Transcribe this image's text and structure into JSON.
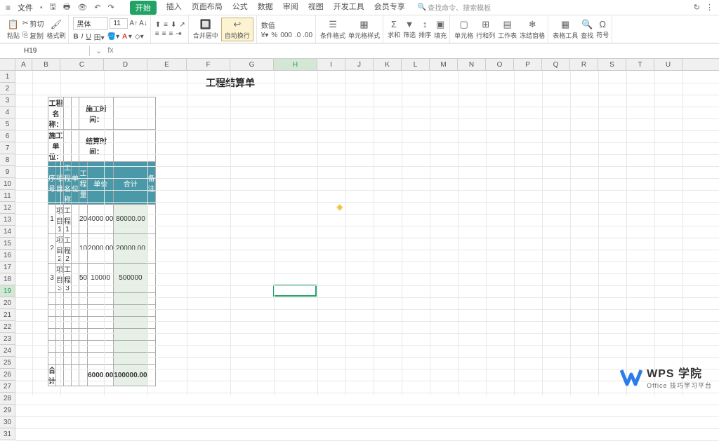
{
  "menu": {
    "file": "文件",
    "tabs": [
      "开始",
      "插入",
      "页面布局",
      "公式",
      "数据",
      "审阅",
      "视图",
      "开发工具",
      "会员专享"
    ],
    "active_tab_index": 0,
    "search_placeholder": "查找命令、搜索模板"
  },
  "ribbon": {
    "paste": "粘贴",
    "cut": "剪切",
    "copy": "复制",
    "format_painter": "格式刷",
    "font_name": "黑体",
    "font_size": "11",
    "merge_center": "合并居中",
    "auto_wrap": "自动换行",
    "number_format": "数值",
    "percent": "%",
    "comma": "000",
    "inc_dec": ".0 .00",
    "cond_format": "条件格式",
    "cell_style": "单元格样式",
    "sum": "求和",
    "filter": "筛选",
    "sort": "排序",
    "fill": "填充",
    "cell": "单元格",
    "row_col": "行和列",
    "worksheet": "工作表",
    "freeze": "冻结窗格",
    "table_tools": "表格工具",
    "find": "查找",
    "symbol": "符号"
  },
  "formula_bar": {
    "name_box": "H19",
    "fx": "fx"
  },
  "columns": [
    "A",
    "B",
    "C",
    "D",
    "E",
    "F",
    "G",
    "H",
    "I",
    "J",
    "K",
    "L",
    "M",
    "N",
    "O",
    "P",
    "Q",
    "R",
    "S",
    "T",
    "U"
  ],
  "rows": [
    1,
    2,
    3,
    4,
    5,
    6,
    7,
    8,
    9,
    10,
    11,
    12,
    13,
    14,
    15,
    16,
    17,
    18,
    19,
    20,
    21,
    22,
    23,
    24,
    25,
    26,
    27,
    28,
    29,
    30,
    31
  ],
  "active_col": "H",
  "active_row": 19,
  "table": {
    "title": "工程结算单",
    "label_proj_name": "工程名称：",
    "label_constr_unit": "施工单位：",
    "label_constr_time": "施工时间：",
    "label_settle_time": "结算时间：",
    "headers": [
      "序号",
      "项目",
      "工程名称",
      "单位",
      "工程量",
      "单价",
      "合计",
      "备注"
    ],
    "rows": [
      {
        "no": "1",
        "item": "项目1",
        "name": "工程1",
        "unit": "",
        "qty": "20",
        "price": "4000.00",
        "total": "80000.00",
        "note": ""
      },
      {
        "no": "2",
        "item": "项目2",
        "name": "工程2",
        "unit": "",
        "qty": "10",
        "price": "2000.00",
        "total": "20000.00",
        "note": ""
      },
      {
        "no": "3",
        "item": "项目3",
        "name": "工程3",
        "unit": "",
        "qty": "50",
        "price": "10000",
        "total": "500000",
        "note": ""
      }
    ],
    "sum_label": "合计",
    "sum_price": "6000.00",
    "sum_total": "100000.00"
  },
  "watermark": {
    "brand": "WPS 学院",
    "sub": "Office 技巧学习平台"
  },
  "chart_data": {
    "type": "table",
    "title": "工程结算单",
    "columns": [
      "序号",
      "项目",
      "工程名称",
      "单位",
      "工程量",
      "单价",
      "合计",
      "备注"
    ],
    "data": [
      [
        1,
        "项目1",
        "工程1",
        "",
        20,
        4000.0,
        80000.0,
        ""
      ],
      [
        2,
        "项目2",
        "工程2",
        "",
        10,
        2000.0,
        20000.0,
        ""
      ],
      [
        3,
        "项目3",
        "工程3",
        "",
        50,
        10000,
        500000,
        ""
      ]
    ],
    "totals": {
      "单价": 6000.0,
      "合计": 100000.0
    }
  }
}
